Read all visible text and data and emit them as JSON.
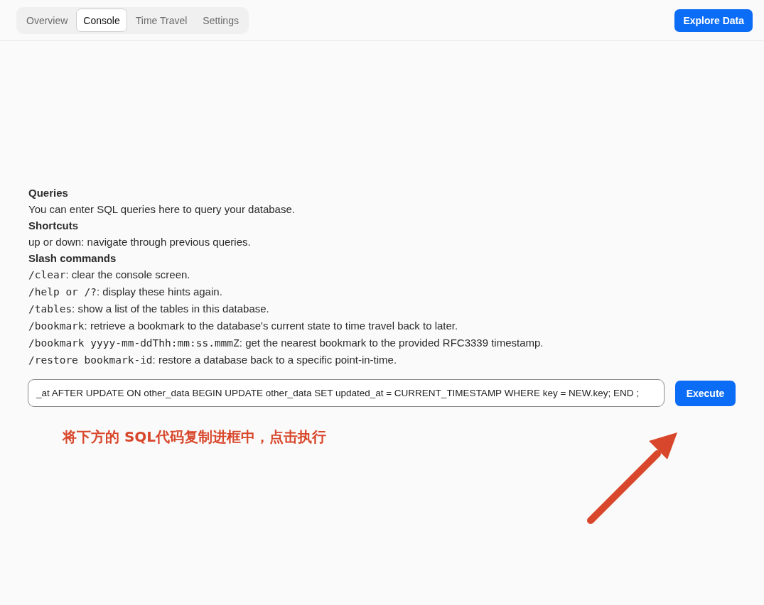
{
  "header": {
    "tabs": [
      {
        "label": "Overview",
        "selected": false
      },
      {
        "label": "Console",
        "selected": true
      },
      {
        "label": "Time Travel",
        "selected": false
      },
      {
        "label": "Settings",
        "selected": false
      }
    ],
    "explore_button": "Explore Data"
  },
  "help": {
    "sections": [
      {
        "heading": "Queries",
        "lines": [
          {
            "text": "You can enter SQL queries here to query your database."
          }
        ]
      },
      {
        "heading": "Shortcuts",
        "lines": [
          {
            "text": "up or down: navigate through previous queries."
          }
        ]
      },
      {
        "heading": "Slash commands",
        "lines": [
          {
            "code": "/clear",
            "text": ": clear the console screen."
          },
          {
            "code": "/help or /?",
            "text": ": display these hints again."
          },
          {
            "code": "/tables",
            "text": ": show a list of the tables in this database."
          },
          {
            "code": "/bookmark",
            "text": ": retrieve a bookmark to the database's current state to time travel back to later."
          },
          {
            "code": "/bookmark yyyy-mm-ddThh:mm:ss.mmmZ",
            "text": ": get the nearest bookmark to the provided RFC3339 timestamp."
          },
          {
            "code": "/restore bookmark-id",
            "text": ": restore a database back to a specific point-in-time."
          }
        ]
      }
    ]
  },
  "console": {
    "query": "_at AFTER UPDATE ON other_data BEGIN UPDATE other_data SET updated_at = CURRENT_TIMESTAMP WHERE key = NEW.key; END ;",
    "execute_button": "Execute"
  },
  "annotation": {
    "text": "将下方的 SQL代码复制进框中，点击执行"
  }
}
